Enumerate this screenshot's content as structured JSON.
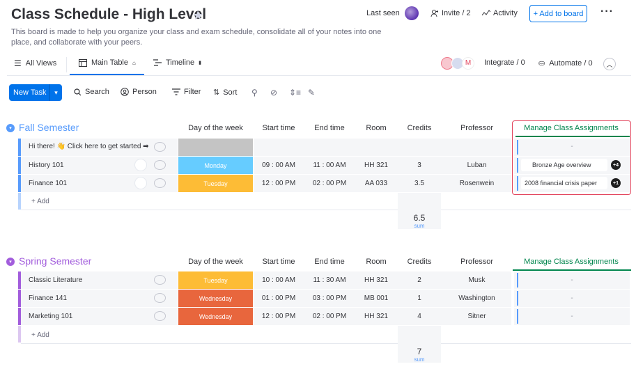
{
  "header": {
    "title": "Class Schedule - High Level",
    "description": "This board is made to help you organize your class and exam schedule, consolidate all of your notes into one place, and collaborate with your peers.",
    "last_seen": "Last seen",
    "invite": "Invite / 2",
    "activity": "Activity",
    "add_to_board": "+ Add to board"
  },
  "tabs": {
    "all_views": "All Views",
    "main_table": "Main Table",
    "timeline": "Timeline",
    "integrate": "Integrate / 0",
    "automate": "Automate / 0"
  },
  "toolbar": {
    "new_task": "New Task",
    "search": "Search",
    "person": "Person",
    "filter": "Filter",
    "sort": "Sort"
  },
  "columns": {
    "day": "Day of the week",
    "start": "Start time",
    "end": "End time",
    "room": "Room",
    "credits": "Credits",
    "professor": "Professor",
    "assignments": "Manage Class Assignments"
  },
  "colors": {
    "fall": "#579bfc",
    "spring": "#a25ddc",
    "monday": "#66ccff",
    "tuesday": "#fdbc36",
    "wednesday": "#e8663d",
    "accent": "#0073ea",
    "highlight_border": "#e2445c",
    "assign_underline": "#00854d"
  },
  "groups": {
    "fall": {
      "title": "Fall Semester",
      "rows": [
        {
          "name": "Hi there! 👋 Click here to get started ➡",
          "day": "",
          "start": "",
          "end": "",
          "room": "",
          "credits": "",
          "professor": "",
          "assignment": "-",
          "badge": ""
        },
        {
          "name": "History 101",
          "day": "Monday",
          "start": "09 : 00 AM",
          "end": "11 : 00 AM",
          "room": "HH 321",
          "credits": "3",
          "professor": "Luban",
          "assignment": "Bronze Age overview",
          "badge": "+4"
        },
        {
          "name": "Finance 101",
          "day": "Tuesday",
          "start": "12 : 00 PM",
          "end": "02 : 00 PM",
          "room": "AA 033",
          "credits": "3.5",
          "professor": "Rosenwein",
          "assignment": "2008 financial crisis paper",
          "badge": "+1"
        }
      ],
      "add": "+ Add",
      "sum_value": "6.5",
      "sum_label": "sum"
    },
    "spring": {
      "title": "Spring Semester",
      "rows": [
        {
          "name": "Classic Literature",
          "day": "Tuesday",
          "start": "10 : 00 AM",
          "end": "11 : 30 AM",
          "room": "HH 321",
          "credits": "2",
          "professor": "Musk",
          "assignment": "-"
        },
        {
          "name": "Finance 141",
          "day": "Wednesday",
          "start": "01 : 00 PM",
          "end": "03 : 00 PM",
          "room": "MB 001",
          "credits": "1",
          "professor": "Washington",
          "assignment": "-"
        },
        {
          "name": "Marketing 101",
          "day": "Wednesday",
          "start": "12 : 00 PM",
          "end": "02 : 00 PM",
          "room": "HH 321",
          "credits": "4",
          "professor": "Sitner",
          "assignment": "-"
        }
      ],
      "add": "+ Add",
      "sum_value": "7",
      "sum_label": "sum"
    }
  }
}
